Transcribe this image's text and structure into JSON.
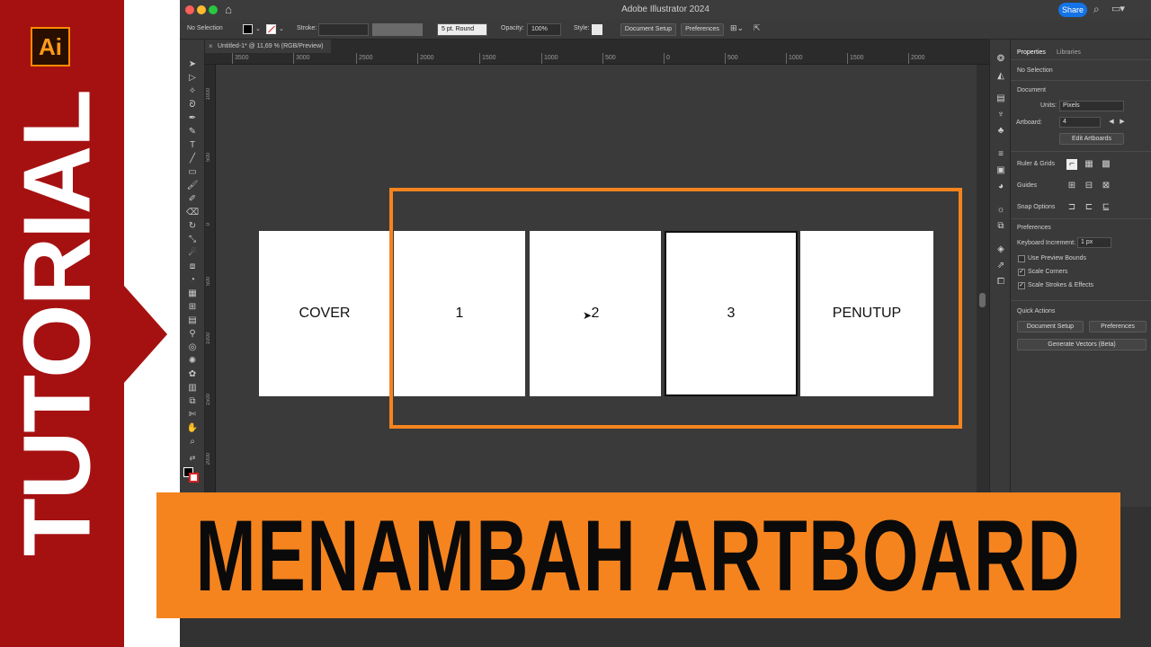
{
  "banner": {
    "logo_text": "Ai",
    "vertical_text": "TUTORIAL",
    "title": "MENAMBAH ARTBOARD",
    "colors": {
      "red": "#a51111",
      "orange": "#f5841f"
    }
  },
  "window": {
    "title": "Adobe Illustrator 2024",
    "share_label": "Share",
    "icons": [
      "home-icon",
      "search-icon",
      "workspace-icon"
    ]
  },
  "control_bar": {
    "selection": "No Selection",
    "stroke_label": "Stroke:",
    "brush_value": "5 pt. Round",
    "opacity_label": "Opacity:",
    "opacity_value": "100%",
    "style_label": "Style:",
    "document_setup": "Document Setup",
    "preferences": "Preferences"
  },
  "document_tab": {
    "label": "Untitled-1* @ 11,69 % (RGB/Preview)",
    "close": "×"
  },
  "ruler": {
    "h_ticks": [
      "3500",
      "3000",
      "2500",
      "2000",
      "1500",
      "1000",
      "500",
      "0",
      "500",
      "1000",
      "1500",
      "2000"
    ],
    "v_ticks": [
      "1000",
      "500",
      "0",
      "500",
      "1000",
      "1500",
      "2000"
    ]
  },
  "artboards": [
    {
      "label": "COVER"
    },
    {
      "label": "1"
    },
    {
      "label": "2"
    },
    {
      "label": "3"
    },
    {
      "label": "PENUTUP"
    }
  ],
  "properties": {
    "tabs": [
      "Properties",
      "Libraries"
    ],
    "no_selection": "No Selection",
    "document_heading": "Document",
    "units_label": "Units:",
    "units_value": "Pixels",
    "artboard_label": "Artboard:",
    "artboard_value": "4",
    "edit_artboards": "Edit Artboards",
    "ruler_grids": "Ruler & Grids",
    "guides": "Guides",
    "snap_options": "Snap Options",
    "preferences_heading": "Preferences",
    "keyboard_increment_label": "Keyboard Increment:",
    "keyboard_increment_value": "1 px",
    "use_preview_bounds": "Use Preview Bounds",
    "scale_corners": "Scale Corners",
    "scale_strokes": "Scale Strokes & Effects",
    "quick_actions": "Quick Actions",
    "document_setup": "Document Setup",
    "preferences": "Preferences",
    "generate_vectors": "Generate Vectors (Beta)"
  }
}
